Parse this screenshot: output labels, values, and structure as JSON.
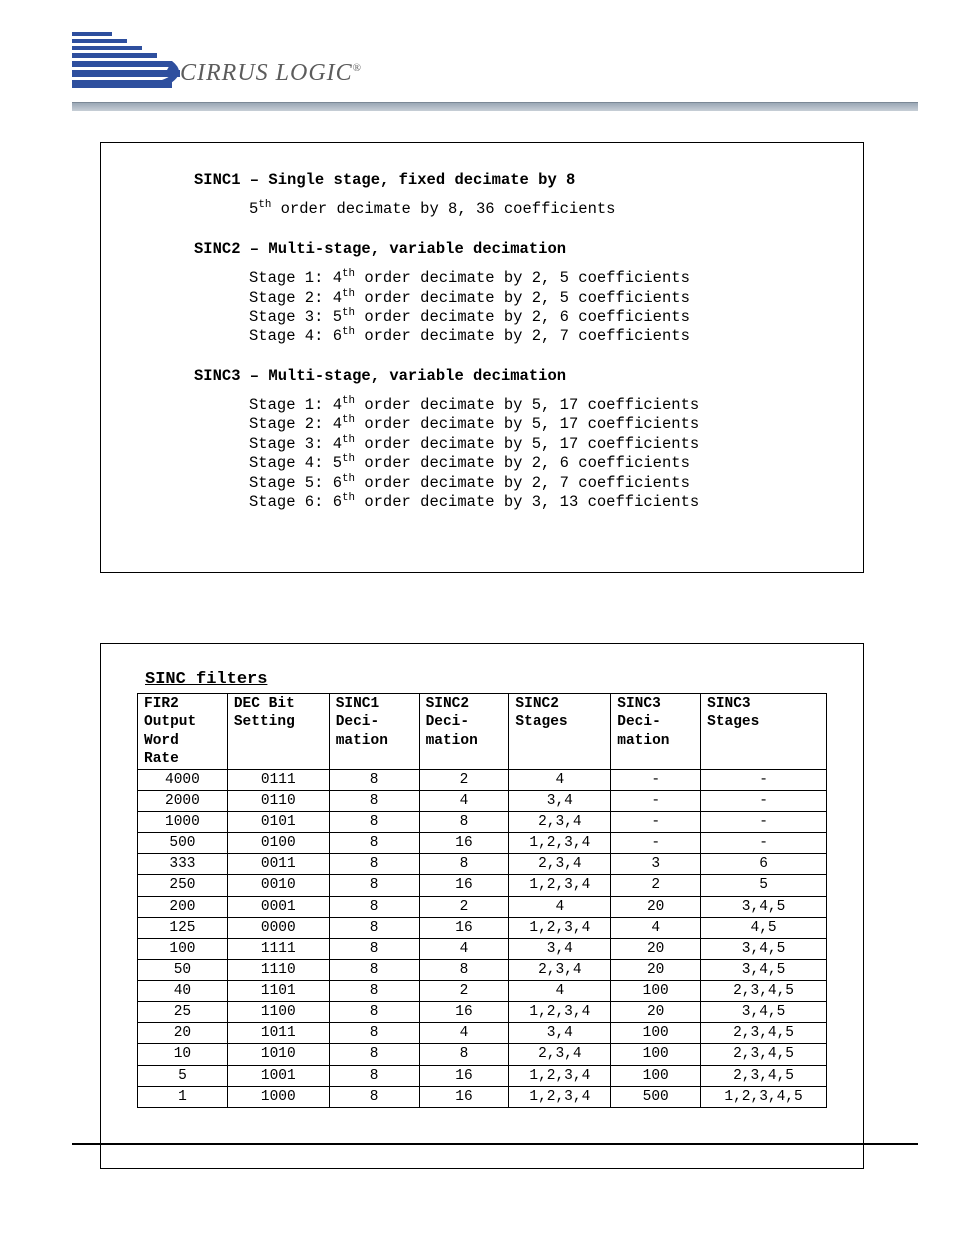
{
  "logo": {
    "brand": "CIRRUS LOGIC",
    "reg": "®"
  },
  "sections": [
    {
      "head": "SINC1 – Single stage, fixed decimate by 8",
      "details": [
        {
          "prefix": "5",
          "sup": "th",
          "rest": " order decimate by 8, 36 coefficients"
        }
      ]
    },
    {
      "head": "SINC2 – Multi-stage, variable decimation",
      "details": [
        {
          "prefix": "Stage 1: 4",
          "sup": "th",
          "rest": " order decimate by 2, 5 coefficients"
        },
        {
          "prefix": "Stage 2: 4",
          "sup": "th",
          "rest": " order decimate by 2, 5 coefficients"
        },
        {
          "prefix": "Stage 3: 5",
          "sup": "th",
          "rest": " order decimate by 2, 6 coefficients"
        },
        {
          "prefix": "Stage 4: 6",
          "sup": "th",
          "rest": " order decimate by 2, 7 coefficients"
        }
      ]
    },
    {
      "head": "SINC3 – Multi-stage, variable decimation",
      "details": [
        {
          "prefix": "Stage 1: 4",
          "sup": "th",
          "rest": " order decimate by 5, 17 coefficients"
        },
        {
          "prefix": "Stage 2: 4",
          "sup": "th",
          "rest": " order decimate by 5, 17 coefficients"
        },
        {
          "prefix": "Stage 3: 4",
          "sup": "th",
          "rest": " order decimate by 5, 17 coefficients"
        },
        {
          "prefix": "Stage 4: 5",
          "sup": "th",
          "rest": " order decimate by 2,  6 coefficients"
        },
        {
          "prefix": "Stage 5: 6",
          "sup": "th",
          "rest": " order decimate by 2,  7 coefficients"
        },
        {
          "prefix": "Stage 6: 6",
          "sup": "th",
          "rest": " order decimate by 3, 13 coefficients"
        }
      ]
    }
  ],
  "table": {
    "title": "SINC filters",
    "headers": [
      "FIR2\nOutput\nWord\nRate",
      "DEC Bit\nSetting",
      "SINC1\nDeci-\nmation",
      "SINC2\nDeci-\nmation",
      "SINC2\nStages",
      "SINC3\nDeci-\nmation",
      "SINC3\nStages"
    ],
    "rows": [
      [
        "4000",
        "0111",
        "8",
        "2",
        "4",
        "-",
        "-"
      ],
      [
        "2000",
        "0110",
        "8",
        "4",
        "3,4",
        "-",
        "-"
      ],
      [
        "1000",
        "0101",
        "8",
        "8",
        "2,3,4",
        "-",
        "-"
      ],
      [
        "500",
        "0100",
        "8",
        "16",
        "1,2,3,4",
        "-",
        "-"
      ],
      [
        "333",
        "0011",
        "8",
        "8",
        "2,3,4",
        "3",
        "6"
      ],
      [
        "250",
        "0010",
        "8",
        "16",
        "1,2,3,4",
        "2",
        "5"
      ],
      [
        "200",
        "0001",
        "8",
        "2",
        "4",
        "20",
        "3,4,5"
      ],
      [
        "125",
        "0000",
        "8",
        "16",
        "1,2,3,4",
        "4",
        "4,5"
      ],
      [
        "100",
        "1111",
        "8",
        "4",
        "3,4",
        "20",
        "3,4,5"
      ],
      [
        "50",
        "1110",
        "8",
        "8",
        "2,3,4",
        "20",
        "3,4,5"
      ],
      [
        "40",
        "1101",
        "8",
        "2",
        "4",
        "100",
        "2,3,4,5"
      ],
      [
        "25",
        "1100",
        "8",
        "16",
        "1,2,3,4",
        "20",
        "3,4,5"
      ],
      [
        "20",
        "1011",
        "8",
        "4",
        "3,4",
        "100",
        "2,3,4,5"
      ],
      [
        "10",
        "1010",
        "8",
        "8",
        "2,3,4",
        "100",
        "2,3,4,5"
      ],
      [
        "5",
        "1001",
        "8",
        "16",
        "1,2,3,4",
        "100",
        "2,3,4,5"
      ],
      [
        "1",
        "1000",
        "8",
        "16",
        "1,2,3,4",
        "500",
        "1,2,3,4,5"
      ]
    ]
  }
}
